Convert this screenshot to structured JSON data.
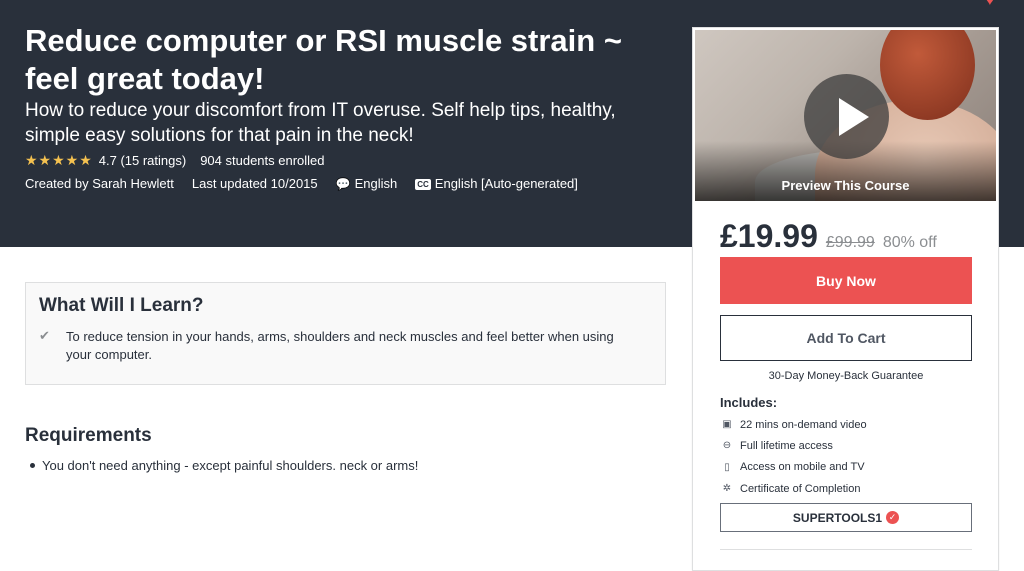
{
  "hero": {
    "title": "Reduce computer or RSI muscle strain ~ feel great today!",
    "subtitle": "How to reduce your discomfort from IT overuse. Self help tips, healthy, simple easy solutions for that pain in the neck!",
    "stars": "★★★★★",
    "rating": "4.7 (15 ratings)",
    "enrolled": "904 students enrolled",
    "created_by": "Created by Sarah Hewlett",
    "last_updated": "Last updated 10/2015",
    "language": "English",
    "captions": "English [Auto-generated]",
    "captions_badge": "CC"
  },
  "sidebar": {
    "preview_label": "Preview This Course",
    "price": "£19.99",
    "original_price": "£99.99",
    "discount": "80% off",
    "buy_label": "Buy Now",
    "cart_label": "Add To Cart",
    "guarantee": "30-Day Money-Back Guarantee",
    "includes_title": "Includes:",
    "includes": [
      {
        "icon": "video-icon",
        "text": "22 mins on-demand video"
      },
      {
        "icon": "infinity-icon",
        "text": "Full lifetime access"
      },
      {
        "icon": "mobile-icon",
        "text": "Access on mobile and TV"
      },
      {
        "icon": "certificate-icon",
        "text": "Certificate of Completion"
      }
    ],
    "coupon_code": "SUPERTOOLS1"
  },
  "learn": {
    "title": "What Will I Learn?",
    "items": [
      "To reduce tension in your hands, arms, shoulders and neck muscles and feel better when using your computer."
    ]
  },
  "requirements": {
    "title": "Requirements",
    "items": [
      "You don't need anything - except painful shoulders. neck or arms!"
    ]
  },
  "colors": {
    "header_bg": "#29303b",
    "accent": "#ec5252",
    "star": "#f4c150"
  }
}
